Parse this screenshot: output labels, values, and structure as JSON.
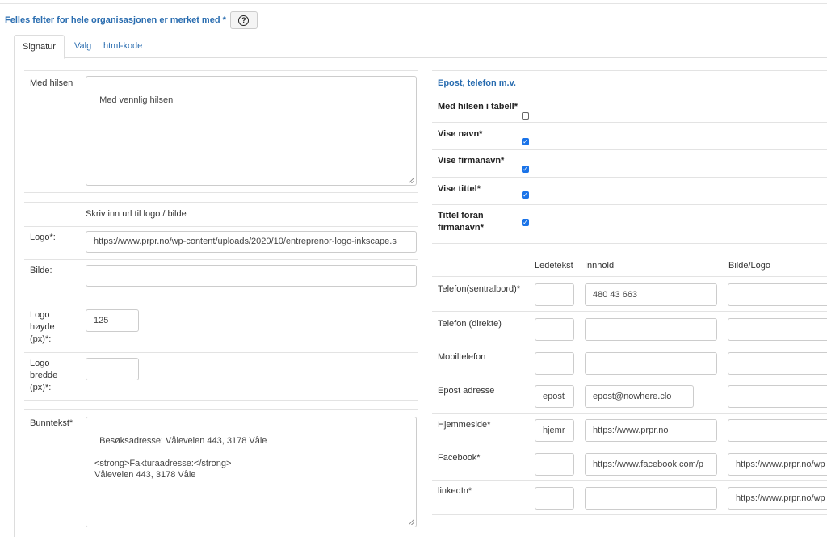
{
  "header": {
    "title": "Felles felter for hele organisasjonen er merket med *"
  },
  "tabs": [
    "Signatur",
    "Valg",
    "html-kode"
  ],
  "left": {
    "greeting_label": "Med hilsen",
    "greeting_value": "Med vennlig hilsen",
    "logo_hint": "Skriv inn url til logo / bilde",
    "logo_label": "Logo*:",
    "logo_value": "https://www.prpr.no/wp-content/uploads/2020/10/entreprenor-logo-inkscape.s",
    "image_label": "Bilde:",
    "image_value": "",
    "logo_height_label": "Logo høyde (px)*:",
    "logo_height_value": "125",
    "logo_width_label": "Logo bredde (px)*:",
    "logo_width_value": "",
    "footer_label": "Bunntekst*",
    "footer_value": "Besøksadresse: Våleveien 443, 3178 Våle\n\n<strong>Fakturaadresse:</strong>\nVåleveien 443, 3178 Våle"
  },
  "right": {
    "section_title": "Epost, telefon m.v.",
    "options": [
      {
        "label": "Med hilsen i tabell*",
        "checked": false
      },
      {
        "label": "Vise navn*",
        "checked": true
      },
      {
        "label": "Vise firmanavn*",
        "checked": true
      },
      {
        "label": "Vise tittel*",
        "checked": true
      },
      {
        "label": "Tittel foran firmanavn*",
        "checked": true
      }
    ],
    "columns": {
      "prompt": "Ledetekst",
      "content": "Innhold",
      "image": "Bilde/Logo"
    },
    "contacts": [
      {
        "label": "Telefon(sentralbord)*",
        "prompt": "",
        "content": "480 43 663",
        "image": ""
      },
      {
        "label": "Telefon (direkte)",
        "prompt": "",
        "content": "",
        "image": ""
      },
      {
        "label": "Mobiltelefon",
        "prompt": "",
        "content": "",
        "image": ""
      },
      {
        "label": "Epost adresse",
        "prompt": "epost",
        "content": "epost@nowhere.clo",
        "image": ""
      },
      {
        "label": "Hjemmeside*",
        "prompt": "hjemr",
        "content": "https://www.prpr.no",
        "image": ""
      },
      {
        "label": "Facebook*",
        "prompt": "",
        "content": "https://www.facebook.com/p",
        "image": "https://www.prpr.no/wp"
      },
      {
        "label": "linkedIn*",
        "prompt": "",
        "content": "",
        "image": "https://www.prpr.no/wp"
      }
    ]
  }
}
